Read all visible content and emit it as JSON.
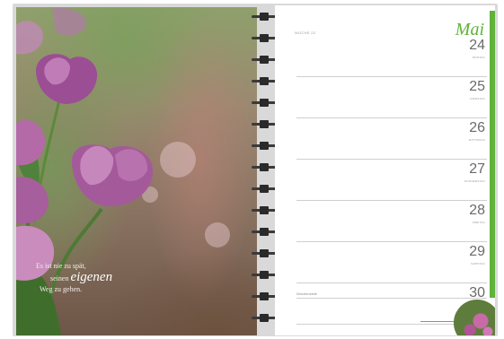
{
  "quote": {
    "line1": "Es ist nie zu spät,",
    "line2_pre": "seinen",
    "line2_em": "eigenen",
    "line3": "Weg zu gehen."
  },
  "planner": {
    "month": "Mai",
    "week_label": "WOCHE 22",
    "days": [
      {
        "num": "24",
        "weekday": "MONTAG",
        "holiday": false
      },
      {
        "num": "25",
        "weekday": "DIENSTAG",
        "holiday": false
      },
      {
        "num": "26",
        "weekday": "MITTWOCH",
        "holiday": false
      },
      {
        "num": "27",
        "weekday": "DONNERSTAG",
        "holiday": false
      },
      {
        "num": "28",
        "weekday": "FREITAG",
        "holiday": false
      },
      {
        "num": "29",
        "weekday": "SAMSTAG",
        "holiday": false
      },
      {
        "num": "30",
        "weekday": "SONNTAG",
        "holiday": true
      }
    ],
    "notes_label": "Wochenziele"
  },
  "colors": {
    "accent": "#5fb23a",
    "holiday": "#e07050"
  }
}
